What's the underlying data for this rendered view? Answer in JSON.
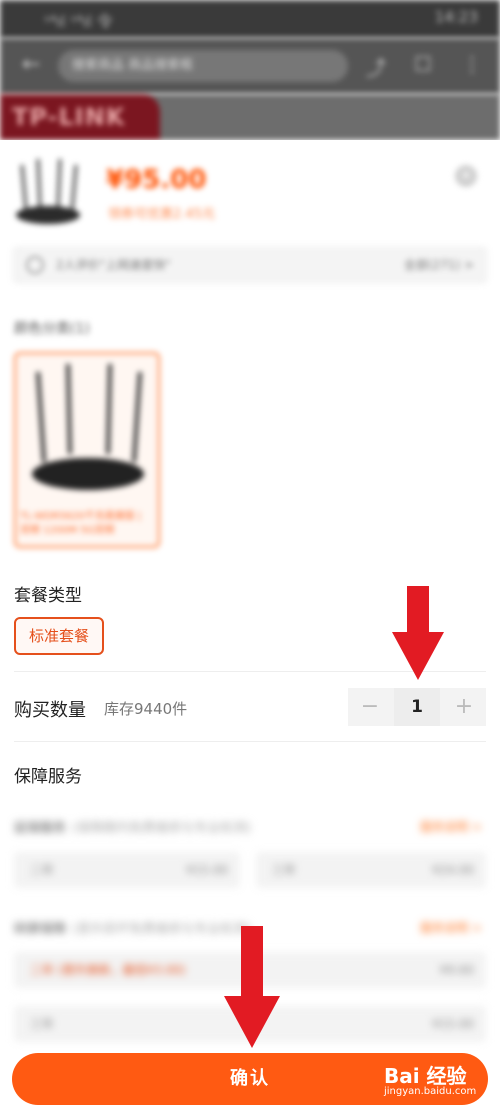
{
  "status_bar": {
    "signal": "ˢ⁴ıl ˢ⁴ıl 令",
    "time": "14:23"
  },
  "top_nav": {
    "search_text": "搜索商品 商品搜索框",
    "back_icon": "arrow-left-icon"
  },
  "brand": {
    "logo_text": "TP-LINK"
  },
  "product": {
    "price": "¥95.00",
    "price_note": "领券可优惠2.45元",
    "review_text": "2人评价\"上网速度快\"",
    "review_more": "全部(271) >"
  },
  "color_section": {
    "label": "颜色分类(1)",
    "option_caption": "TL-WDR5620千兆易展版 | 双频 1200M 5G双频"
  },
  "package_section": {
    "label": "套餐类型",
    "option": "标准套餐"
  },
  "quantity_section": {
    "label": "购买数量",
    "stock": "库存9440件",
    "value": "1",
    "minus": "−",
    "plus": "+"
  },
  "service_section": {
    "label": "保障服务",
    "groups": [
      {
        "title": "延保服务",
        "subtitle": "(保障期内免费维修与专业检测)",
        "link": "服务说明 >",
        "options": [
          {
            "name": "二年",
            "price": "¥15.00"
          },
          {
            "name": "三年",
            "price": "¥24.00"
          }
        ]
      },
      {
        "title": "碎屏保障",
        "subtitle": "(意外损坏免费维修与专业检测)",
        "link": "服务说明 >",
        "options": [
          {
            "name": "二年 (意外换新，最低¥3.00)",
            "price": "¥9.60"
          },
          {
            "name": "三年",
            "price": "¥15.00"
          }
        ]
      }
    ]
  },
  "confirm_button": {
    "label": "确认"
  },
  "watermark": {
    "brand": "Bai 经验",
    "site": "jingyan.baidu.com"
  },
  "colors": {
    "accent": "#ff5a12",
    "price": "#ff5000",
    "arrow": "#e21b23"
  }
}
